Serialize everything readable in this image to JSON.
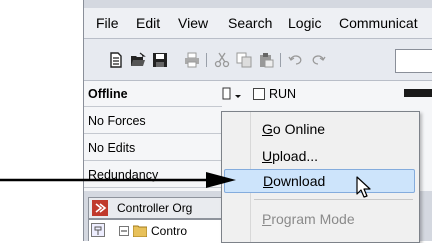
{
  "menubar": {
    "items": [
      "File",
      "Edit",
      "View",
      "Search",
      "Logic",
      "Communicat"
    ]
  },
  "toolbar": {
    "icons": [
      "new-file-icon",
      "open-folder-icon",
      "save-icon",
      "print-icon",
      "cut-icon",
      "copy-icon",
      "paste-icon",
      "undo-icon",
      "redo-icon"
    ]
  },
  "status": {
    "mode": "Offline",
    "forces": "No Forces",
    "edits": "No Edits",
    "redundancy": "Redundancy",
    "run_label": "RUN"
  },
  "organizer": {
    "title": "Controller Org",
    "tree_item": "Contro"
  },
  "context_menu": {
    "items": [
      {
        "label": "Go Online",
        "mnemonic": "G",
        "rest": "o Online"
      },
      {
        "label": "Upload...",
        "mnemonic": "U",
        "rest": "pload..."
      },
      {
        "label": "Download",
        "mnemonic": "D",
        "rest": "ownload"
      },
      {
        "label": "Program Mode",
        "mnemonic": "P",
        "rest": "rogram Mode"
      }
    ],
    "highlighted": "Download",
    "disabled": [
      "Program Mode"
    ]
  },
  "colors": {
    "highlight_bg": "#cde4fb",
    "highlight_border": "#84acdd",
    "organizer_icon": "#c0392b"
  }
}
